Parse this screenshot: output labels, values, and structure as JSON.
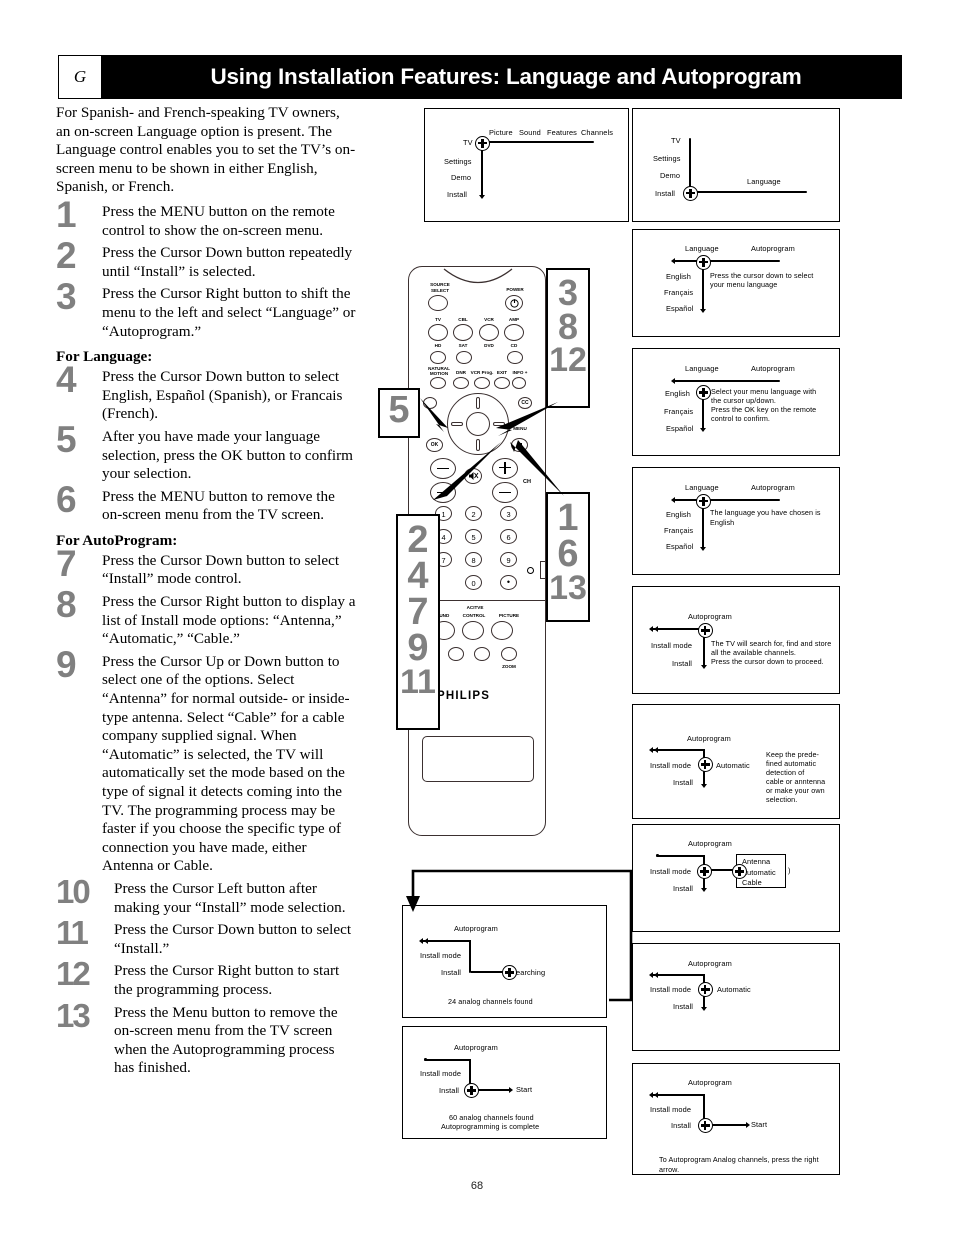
{
  "header": {
    "chapter_letter": "G",
    "title": "Using Installation Features: Language and Autoprogram"
  },
  "page_number": "68",
  "intro": "For Spanish- and French-speaking TV owners, an on-screen Language option is present. The Language control enables you to set the TV’s on-screen menu to be shown in either English, Spanish, or French.",
  "subheads": {
    "language": "For Language:",
    "autoprogram": "For AutoProgram:"
  },
  "steps": [
    {
      "num": "1",
      "text": "Press the MENU button on the remote control to show the on-screen menu."
    },
    {
      "num": "2",
      "text": "Press the Cursor Down button repeatedly until “Install” is selected."
    },
    {
      "num": "3",
      "text": "Press the Cursor Right button to shift the menu to the left and select “Language” or “Autoprogram.”"
    },
    {
      "num": "4",
      "text": "Press the Cursor Down button to select English, Español (Spanish), or Francais (French)."
    },
    {
      "num": "5",
      "text": "After you have made your language selection, press the OK button to confirm your selection."
    },
    {
      "num": "6",
      "text": "Press the MENU button to remove the on-screen menu from the TV screen."
    },
    {
      "num": "7",
      "text": "Press the Cursor Down button to select “Install” mode control."
    },
    {
      "num": "8",
      "text": "Press the Cursor Right button to display a list of Install mode options: “Antenna,” “Automatic,” “Cable.”"
    },
    {
      "num": "9",
      "text": "Press the Cursor Up or Down button to select one of the options. Select “Antenna” for normal outside- or inside-type antenna. Select “Cable” for a cable company supplied signal. When “Automatic” is selected, the TV will automatically set the mode based on the type of signal it detects coming into the TV. The programming process may be faster if you choose the specific type of connection you have made, either Antenna or Cable."
    },
    {
      "num": "10",
      "text": "Press the Cursor Left button after making your “Install” mode selection."
    },
    {
      "num": "11",
      "text": "Press the Cursor Down button to select “Install.”"
    },
    {
      "num": "12",
      "text": "Press the Cursor Right button to start the programming process."
    },
    {
      "num": "13",
      "text": "Press the Menu button to remove the on-screen menu from the TV screen when the Autoprogramming process has finished."
    }
  ],
  "remote": {
    "brand": "PHILIPS",
    "source_select": "SOURCE\nSELECT",
    "source_select_l1": "SOURCE",
    "source_select_l2": "SELECT",
    "power": "POWER",
    "row_tv": "TV",
    "row_cbl": "CBL",
    "row_vcr": "VCR",
    "row_amp": "AMP",
    "row_hd": "HD",
    "row_sat": "SAT",
    "row_dvd": "DVD",
    "row_cd": "CD",
    "natural_motion_l1": "NATURAL",
    "natural_motion_l2": "MOTION",
    "dnr": "DNR",
    "vcr_prog": "VCR Prog.",
    "exit": "EXIT",
    "info": "INFO +",
    "ok": "OK",
    "menu": "MENU",
    "cc": "CC",
    "ch": "CH",
    "active_l1": "ACITVE",
    "sound": "SOUND",
    "control": "CONTROL",
    "picture": "PICTURE",
    "zoom": "ZOOM",
    "keys": [
      "1",
      "2",
      "3",
      "4",
      "5",
      "6",
      "7",
      "8",
      "9",
      "0"
    ],
    "dot_key": "•"
  },
  "callouts": {
    "right_top": [
      "3",
      "8",
      "12"
    ],
    "right_bottom": [
      "1",
      "6",
      "13"
    ],
    "left_top": [
      "5"
    ],
    "left_bottom": [
      "2",
      "4",
      "7",
      "9",
      "11"
    ]
  },
  "menus": {
    "m1": {
      "left_items": [
        "TV",
        "Settings",
        "Demo",
        "Install"
      ],
      "top_items": [
        "Picture",
        "Sound",
        "Features",
        "Channels"
      ]
    },
    "m2": {
      "left_items": [
        "TV",
        "Settings",
        "Demo",
        "Install"
      ],
      "right_item": "Language"
    },
    "m3": {
      "top_left": "Language",
      "top_right": "Autoprogram",
      "left_items": [
        "English",
        "Français",
        "Español"
      ],
      "body": "Press the cursor down to select your menu language",
      "body_lines": [
        "Press the cursor down to select",
        "your menu language"
      ]
    },
    "m4": {
      "top_left": "Language",
      "top_right": "Autoprogram",
      "left_items": [
        "English",
        "Français",
        "Español"
      ],
      "body_lines": [
        "Select your menu language with",
        "the cursor up/down.",
        "Press the OK key on the remote",
        "control to confirm."
      ]
    },
    "m5": {
      "top_left": "Language",
      "top_right": "Autoprogram",
      "left_items": [
        "English",
        "Français",
        "Español"
      ],
      "body_lines": [
        "The language you have chosen is",
        "English"
      ]
    },
    "m6": {
      "title": "Autoprogram",
      "left_items": [
        "Install mode",
        "Install"
      ],
      "body_lines": [
        "The TV will search for, find and store",
        "all the available channels.",
        "Press the cursor down to proceed."
      ]
    },
    "m7": {
      "title": "Autoprogram",
      "left_items": [
        "Install mode",
        "Install"
      ],
      "value": "Automatic",
      "body_lines": [
        "Keep the prede-",
        "fined automatic",
        "detection of",
        "cable or anntenna",
        "or make your own",
        "selection."
      ]
    },
    "m8": {
      "title": "Autoprogram",
      "left_items": [
        "Install mode",
        "Install"
      ],
      "options": [
        "Antenna",
        "Automatic",
        "Cable"
      ]
    },
    "m9": {
      "title": "Autoprogram",
      "left_items": [
        "Install mode",
        "Install"
      ],
      "value": "Automatic"
    },
    "m10": {
      "title": "Autoprogram",
      "left_items": [
        "Install mode",
        "Install"
      ],
      "value": "Start",
      "footer": "To Autoprogram Analog channels, press the right arrow."
    },
    "m11": {
      "title": "Autoprogram",
      "left_items": [
        "Install mode",
        "Install"
      ],
      "value": "Searching",
      "footer": "24 analog channels found"
    },
    "m12": {
      "title": "Autoprogram",
      "left_items": [
        "Install mode",
        "Install"
      ],
      "value": "Start",
      "footer_lines": [
        "60 analog channels found",
        "Autoprogramming is complete"
      ]
    }
  }
}
